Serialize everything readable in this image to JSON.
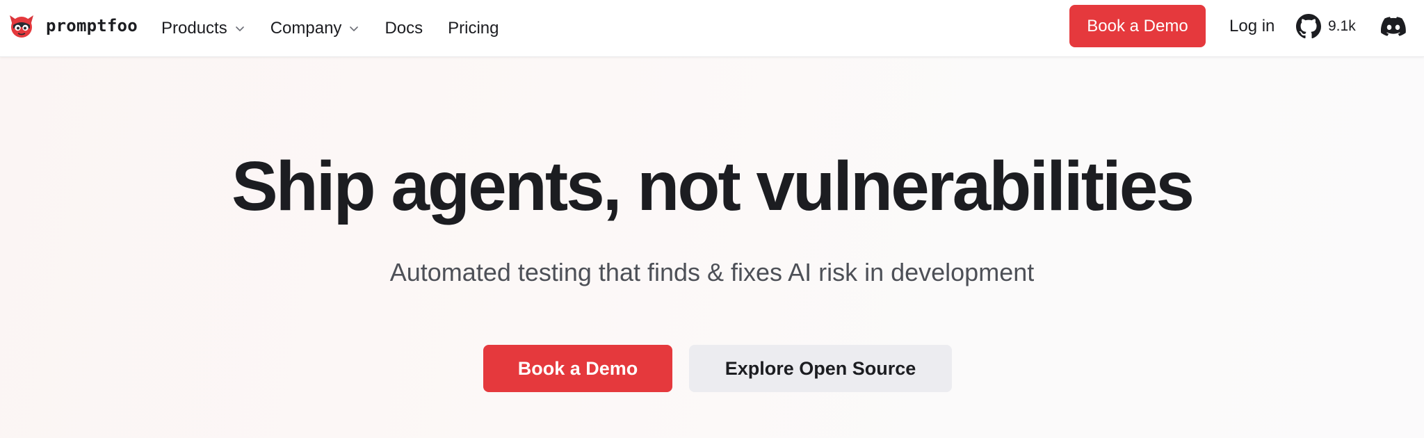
{
  "nav": {
    "brand": "promptfoo",
    "links": [
      {
        "label": "Products",
        "has_dropdown": true
      },
      {
        "label": "Company",
        "has_dropdown": true
      },
      {
        "label": "Docs",
        "has_dropdown": false
      },
      {
        "label": "Pricing",
        "has_dropdown": false
      }
    ],
    "book_demo": "Book a Demo",
    "login": "Log in",
    "github_stars": "9.1k"
  },
  "hero": {
    "title": "Ship agents, not vulnerabilities",
    "subtitle": "Automated testing that finds & fixes AI risk in development",
    "primary_cta": "Book a Demo",
    "secondary_cta": "Explore Open Source"
  },
  "icons": {
    "brand": "promptfoo-logo-icon",
    "chevron": "chevron-down-icon",
    "github": "github-icon",
    "discord": "discord-icon"
  },
  "colors": {
    "accent": "#e5393d",
    "text": "#1c1d21",
    "muted_text": "#4d5057",
    "secondary_button": "#ececf0"
  }
}
